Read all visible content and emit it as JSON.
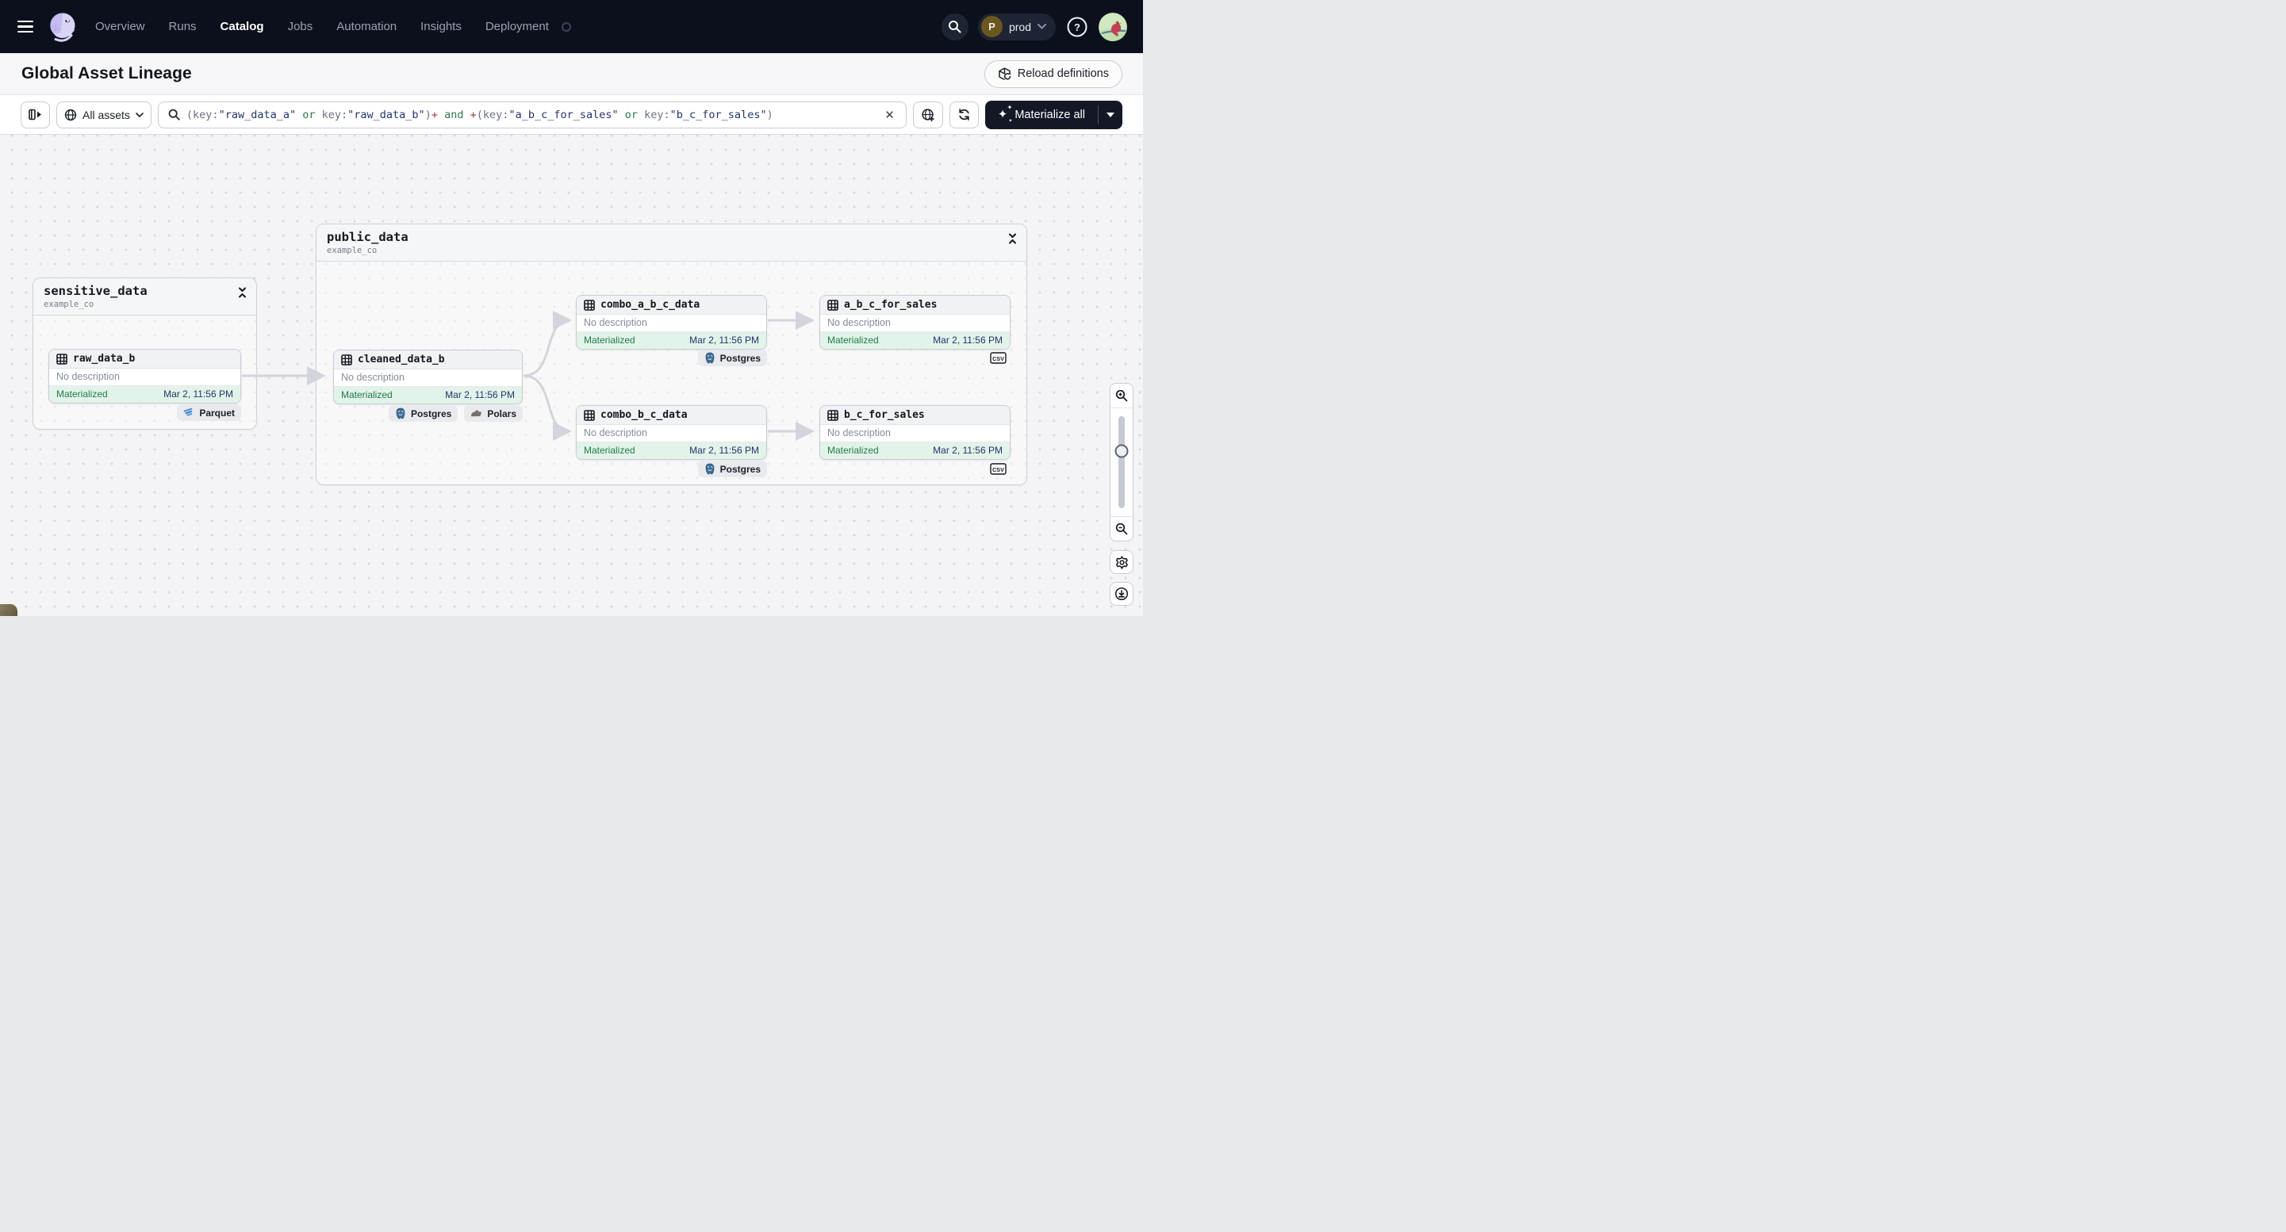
{
  "nav": {
    "items": [
      {
        "label": "Overview",
        "active": false
      },
      {
        "label": "Runs",
        "active": false
      },
      {
        "label": "Catalog",
        "active": true
      },
      {
        "label": "Jobs",
        "active": false
      },
      {
        "label": "Automation",
        "active": false
      },
      {
        "label": "Insights",
        "active": false
      },
      {
        "label": "Deployment",
        "active": false
      }
    ],
    "env": {
      "initial": "P",
      "name": "prod"
    },
    "colors": {
      "bar_bg": "#0c101d",
      "pill_bg": "#1e2433",
      "env_avatar_bg": "#6b561f"
    }
  },
  "header": {
    "title": "Global Asset Lineage",
    "reload_label": "Reload definitions"
  },
  "toolbar": {
    "scope_label": "All assets",
    "materialize_label": "Materialize all",
    "clear_label": "✕",
    "token_colors": {
      "punct": "#6a7384",
      "value": "#23356d",
      "op": "#2c7a4b",
      "plus": "#9e3a3a"
    },
    "query_tokens": [
      {
        "t": "(key:",
        "c": "punct"
      },
      {
        "t": "\"raw_data_a\"",
        "c": "value"
      },
      {
        "t": " ",
        "c": "punct"
      },
      {
        "t": "or",
        "c": "op"
      },
      {
        "t": " key:",
        "c": "punct"
      },
      {
        "t": "\"raw_data_b\"",
        "c": "value"
      },
      {
        "t": ")",
        "c": "punct"
      },
      {
        "t": "+",
        "c": "plus"
      },
      {
        "t": " ",
        "c": "punct"
      },
      {
        "t": "and",
        "c": "op"
      },
      {
        "t": " ",
        "c": "punct"
      },
      {
        "t": "+",
        "c": "plus"
      },
      {
        "t": "(key:",
        "c": "punct"
      },
      {
        "t": "\"a_b_c_for_sales\"",
        "c": "value"
      },
      {
        "t": " ",
        "c": "punct"
      },
      {
        "t": "or",
        "c": "op"
      },
      {
        "t": " key:",
        "c": "punct"
      },
      {
        "t": "\"b_c_for_sales\"",
        "c": "value"
      },
      {
        "t": ")",
        "c": "punct"
      }
    ]
  },
  "graph": {
    "groups": [
      {
        "name": "sensitive_data",
        "subtitle": "example_co"
      },
      {
        "name": "public_data",
        "subtitle": "example_co"
      }
    ],
    "nodes": [
      {
        "name": "raw_data_b",
        "description": "No description",
        "status": "Materialized",
        "timestamp": "Mar 2, 11:56 PM"
      },
      {
        "name": "cleaned_data_b",
        "description": "No description",
        "status": "Materialized",
        "timestamp": "Mar 2, 11:56 PM"
      },
      {
        "name": "combo_a_b_c_data",
        "description": "No description",
        "status": "Materialized",
        "timestamp": "Mar 2, 11:56 PM"
      },
      {
        "name": "a_b_c_for_sales",
        "description": "No description",
        "status": "Materialized",
        "timestamp": "Mar 2, 11:56 PM"
      },
      {
        "name": "combo_b_c_data",
        "description": "No description",
        "status": "Materialized",
        "timestamp": "Mar 2, 11:56 PM"
      },
      {
        "name": "b_c_for_sales",
        "description": "No description",
        "status": "Materialized",
        "timestamp": "Mar 2, 11:56 PM"
      }
    ],
    "badges": {
      "parquet": "Parquet",
      "postgres": "Postgres",
      "polars": "Polars",
      "csv": "CSV"
    },
    "status_colors": {
      "materialized_bg": "#e2f3e9",
      "materialized_text": "#1e7b4d",
      "timestamp_text": "#26336e"
    }
  },
  "icons": {
    "nav": [
      "menu-icon",
      "dagster-logo",
      "search-icon",
      "chevron-down-icon",
      "help-icon",
      "user-avatar"
    ],
    "toolbar": [
      "panel-toggle-icon",
      "globe-icon",
      "magnifier-icon",
      "clear-icon",
      "globe-plus-icon",
      "refresh-icon",
      "sparkle-icon",
      "caret-down-icon"
    ],
    "graph": [
      "table-icon",
      "collapse-icon",
      "parquet-icon",
      "postgres-icon",
      "polars-icon",
      "csv-icon"
    ],
    "controls": [
      "zoom-in-icon",
      "zoom-out-icon",
      "slider-handle",
      "gear-icon",
      "download-icon"
    ]
  }
}
